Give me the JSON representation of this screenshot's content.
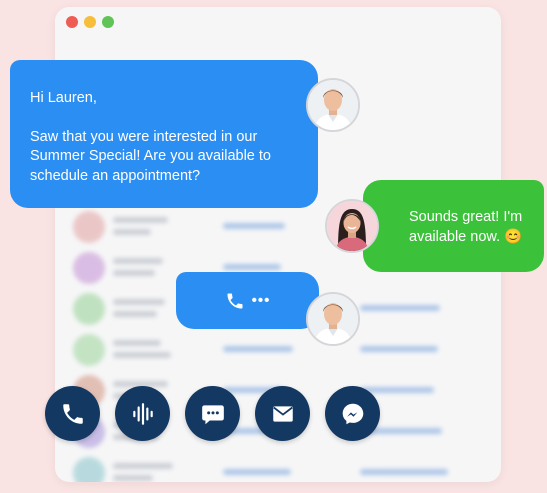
{
  "window": {
    "controls": [
      "close",
      "minimize",
      "maximize"
    ]
  },
  "messages": [
    {
      "from": "agent",
      "greeting": "Hi Lauren,",
      "lines": [
        "Saw that you were interested in our",
        "Summer Special! Are you available to",
        "schedule an appointment?"
      ]
    },
    {
      "from": "customer",
      "lines": [
        "Sounds great! I'm",
        "available now. 😊"
      ]
    },
    {
      "from": "agent",
      "type": "call",
      "dots": "•••"
    }
  ],
  "channel_buttons": [
    {
      "icon": "phone-icon"
    },
    {
      "icon": "voice-waveform-icon"
    },
    {
      "icon": "sms-chat-icon"
    },
    {
      "icon": "email-envelope-icon"
    },
    {
      "icon": "messenger-icon"
    }
  ],
  "colors": {
    "background": "#fae3e3",
    "agent_bubble": "#2b8ef3",
    "customer_bubble": "#3cc13b",
    "channel_button": "#133963"
  }
}
